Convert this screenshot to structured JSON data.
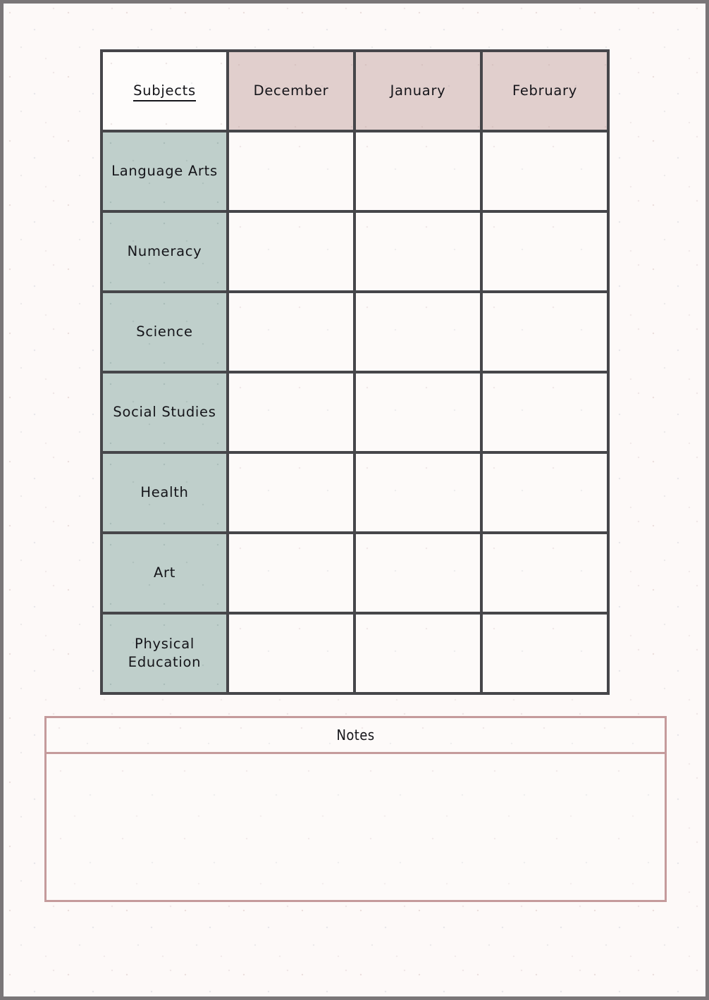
{
  "page": {
    "background_color": "#fdf9f8",
    "outer_border_color": "#7a7678"
  },
  "planner": {
    "border_color": "#46464a",
    "subject_header_bg": "#fefcfb",
    "month_header_bg": "#e1cfcd",
    "subject_cell_bg": "#bfcfcb",
    "entry_cell_bg": "#fdfaf9",
    "columns": [
      {
        "label": "Subjects",
        "underlined": true
      },
      {
        "label": "December",
        "underlined": false
      },
      {
        "label": "January",
        "underlined": false
      },
      {
        "label": "February",
        "underlined": false
      }
    ],
    "rows": [
      {
        "subject": "Language Arts",
        "december": "",
        "january": "",
        "february": ""
      },
      {
        "subject": "Numeracy",
        "december": "",
        "january": "",
        "february": ""
      },
      {
        "subject": "Science",
        "december": "",
        "january": "",
        "february": ""
      },
      {
        "subject": "Social Studies",
        "december": "",
        "january": "",
        "february": ""
      },
      {
        "subject": "Health",
        "december": "",
        "january": "",
        "february": ""
      },
      {
        "subject": "Art",
        "december": "",
        "january": "",
        "february": ""
      },
      {
        "subject": "Physical Education",
        "december": "",
        "january": "",
        "february": ""
      }
    ]
  },
  "notes": {
    "title": "Notes",
    "content": "",
    "border_color": "#c59b9c",
    "background_color": "#fdfaf9"
  }
}
